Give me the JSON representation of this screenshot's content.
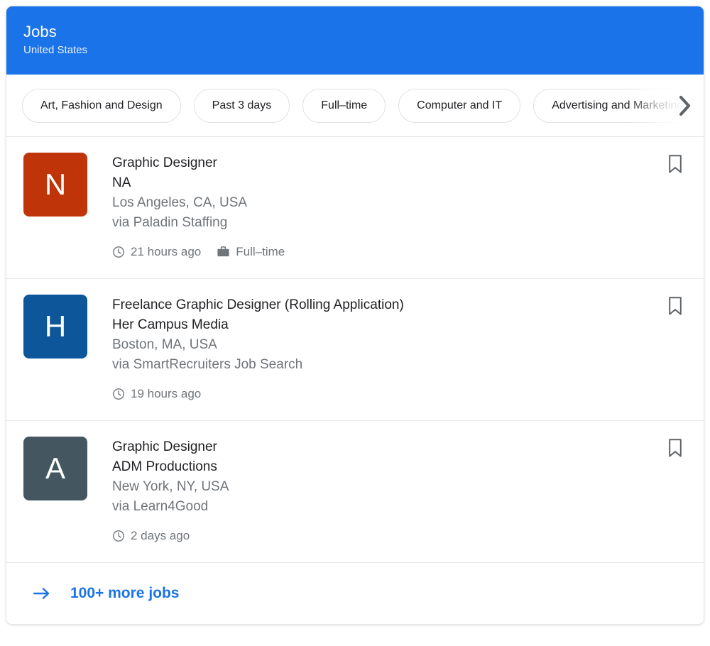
{
  "header": {
    "title": "Jobs",
    "subtitle": "United States",
    "background_color": "#1a73e8"
  },
  "filters": {
    "chips": [
      {
        "label": "Art, Fashion and Design"
      },
      {
        "label": "Past 3 days"
      },
      {
        "label": "Full–time"
      },
      {
        "label": "Computer and IT"
      },
      {
        "label": "Advertising and Marketing"
      }
    ],
    "next_icon": "chevron-right-icon"
  },
  "jobs": [
    {
      "logo_letter": "N",
      "logo_color": "#c0340a",
      "title": "Graphic Designer",
      "company": "NA",
      "location": "Los Angeles, CA, USA",
      "via": "via Paladin Staffing",
      "posted": "21 hours ago",
      "employment_type": "Full–time",
      "bookmark_icon": "bookmark-icon"
    },
    {
      "logo_letter": "H",
      "logo_color": "#0d5699",
      "title": "Freelance Graphic Designer (Rolling Application)",
      "company": "Her Campus Media",
      "location": "Boston, MA, USA",
      "via": "via SmartRecruiters Job Search",
      "posted": "19 hours ago",
      "employment_type": "",
      "bookmark_icon": "bookmark-icon"
    },
    {
      "logo_letter": "A",
      "logo_color": "#445761",
      "title": "Graphic Designer",
      "company": "ADM Productions",
      "location": "New York, NY, USA",
      "via": "via Learn4Good",
      "posted": "2 days ago",
      "employment_type": "",
      "bookmark_icon": "bookmark-icon"
    }
  ],
  "footer": {
    "label": "100+ more jobs",
    "arrow_icon": "arrow-right-icon",
    "link_color": "#1a73e8"
  }
}
